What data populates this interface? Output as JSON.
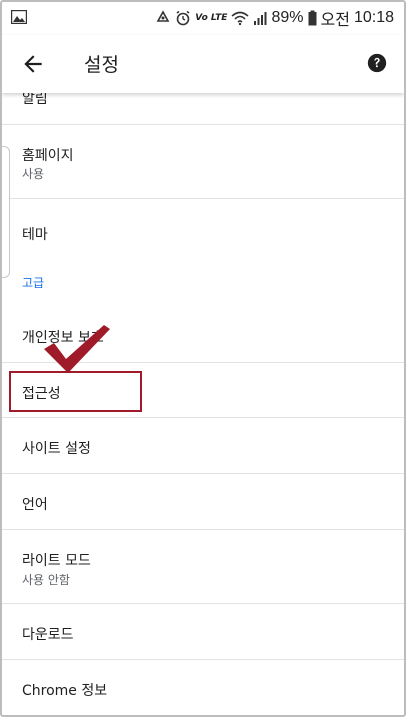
{
  "status_bar": {
    "battery": "89%",
    "ampm": "오전",
    "time": "10:18",
    "volte": "Vo LTE"
  },
  "toolbar": {
    "title": "설정"
  },
  "rows": [
    {
      "id": "notifications",
      "title": "알림"
    },
    {
      "id": "homepage",
      "title": "홈페이지",
      "subtitle": "사용"
    },
    {
      "id": "theme",
      "title": "테마"
    },
    {
      "id": "privacy",
      "title": "개인정보 보호"
    },
    {
      "id": "accessibility",
      "title": "접근성"
    },
    {
      "id": "site-settings",
      "title": "사이트 설정"
    },
    {
      "id": "language",
      "title": "언어"
    },
    {
      "id": "lite-mode",
      "title": "라이트 모드",
      "subtitle": "사용 안함"
    },
    {
      "id": "downloads",
      "title": "다운로드"
    },
    {
      "id": "about-chrome",
      "title": "Chrome 정보"
    }
  ],
  "sections": {
    "advanced": "고급"
  },
  "colors": {
    "accent": "#1a73e8",
    "highlight": "#a01b2a"
  }
}
